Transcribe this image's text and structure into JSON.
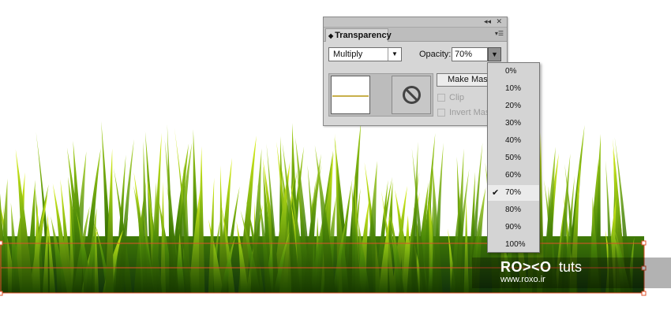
{
  "panel": {
    "title": "Transparency",
    "collapse_icon": "double-chevron-left-icon",
    "close_icon": "close-icon",
    "menu_icon": "panel-menu-icon",
    "blend_mode": "Multiply",
    "opacity_label": "Opacity:",
    "opacity_value": "70%",
    "make_mask_label": "Make Mask",
    "clip_label": "Clip",
    "invert_mask_label": "Invert Mask"
  },
  "dropdown": {
    "options": [
      "0%",
      "10%",
      "20%",
      "30%",
      "40%",
      "50%",
      "60%",
      "70%",
      "80%",
      "90%",
      "100%"
    ],
    "selected": "70%"
  },
  "watermark": {
    "logo": "RO><O",
    "tuts": "tuts",
    "url": "www.roxo.ir"
  },
  "colors": {
    "grass_dark": "#1f4a00",
    "grass_mid": "#5a9a0a",
    "grass_light": "#c8e620",
    "selection_red": "#e0502a"
  }
}
